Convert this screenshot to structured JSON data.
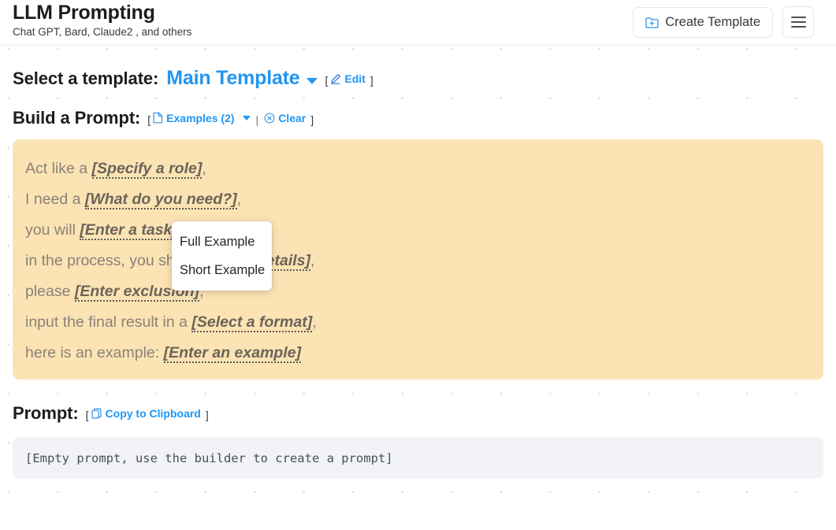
{
  "header": {
    "title": "LLM Prompting",
    "subtitle": "Chat GPT, Bard, Claude2 , and others",
    "create_template_label": "Create Template",
    "create_template_icon": "folder-plus-icon",
    "menu_icon": "hamburger-menu-icon"
  },
  "template_selector": {
    "label": "Select a template:",
    "selected": "Main Template",
    "caret_icon": "chevron-down-icon",
    "bracket_open": "[",
    "bracket_close": "]",
    "edit_label": "Edit",
    "edit_icon": "pencil-icon"
  },
  "builder": {
    "heading": "Build a Prompt:",
    "bracket_open": "[",
    "bracket_close": "]",
    "examples_label": "Examples (2)",
    "examples_icon": "document-icon",
    "examples_caret_icon": "chevron-down-icon",
    "separator": "|",
    "clear_label": "Clear",
    "clear_icon": "circle-x-icon",
    "card_color": "#fbe3b4",
    "lines": [
      {
        "prefix": "Act like a ",
        "placeholder": "[Specify a role]",
        "suffix": ","
      },
      {
        "prefix": "I need a ",
        "placeholder": "[What do you need?]",
        "suffix": ","
      },
      {
        "prefix": "you will ",
        "placeholder": "[Enter a task]",
        "suffix": ","
      },
      {
        "prefix": "in the process, you should ",
        "placeholder": "[Enter details]",
        "suffix": ","
      },
      {
        "prefix": "please ",
        "placeholder": "[Enter exclusion]",
        "suffix": ","
      },
      {
        "prefix": "input the final result in a ",
        "placeholder": "[Select a format]",
        "suffix": ","
      },
      {
        "prefix": "here is an example: ",
        "placeholder": "[Enter an example]",
        "suffix": ""
      }
    ]
  },
  "examples_menu": {
    "open": true,
    "items": [
      {
        "label": "Full Example"
      },
      {
        "label": "Short Example"
      }
    ]
  },
  "prompt": {
    "heading": "Prompt:",
    "bracket_open": "[",
    "bracket_close": "]",
    "copy_label": "Copy to Clipboard",
    "copy_icon": "copy-icon",
    "output_text": "[Empty prompt, use the builder to create a prompt]"
  },
  "colors": {
    "accent": "#2196f3",
    "card": "#fbe3b4",
    "output_bg": "#f1f3f6",
    "placeholder_text": "#6b6459"
  }
}
